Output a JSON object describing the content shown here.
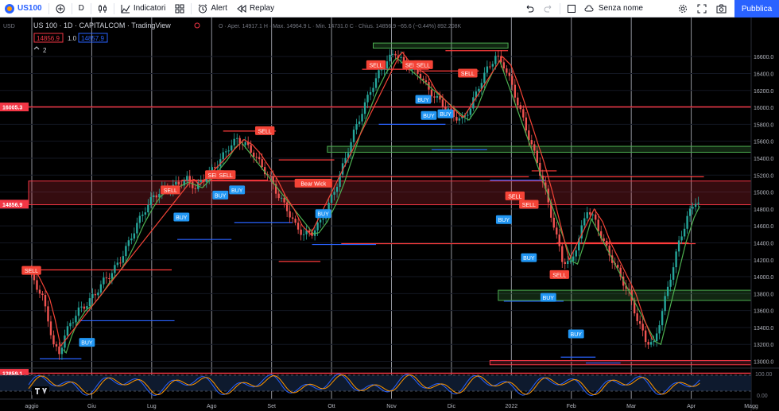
{
  "toolbar": {
    "symbol": "US100",
    "interval": "D",
    "indicators_label": "Indicatori",
    "alert_label": "Alert",
    "replay_label": "Replay",
    "layout_name": "Senza nome",
    "publish_label": "Pubblica"
  },
  "legend": {
    "title": "US 100 · 1D · CAPITALCOM · TradingView",
    "ohlc": "O · Aper. 14917.1  H · Max. 14964.9  L · Min. 14731.0  C · Chius. 14856.9  −65.6 (−0.44%)  892.208K",
    "bid": "14856.9",
    "spread": "1.0",
    "ask": "14857.9",
    "collapse": "2"
  },
  "price_axis": {
    "currency": "USD",
    "tags": [
      {
        "label": "16005.3",
        "value": 16005.3,
        "color": "#f23645"
      },
      {
        "label": "14856.9",
        "value": 14856.9,
        "color": "#f23645"
      },
      {
        "label": "12859.1",
        "value": 12859.1,
        "color": "#f23645"
      }
    ]
  },
  "oscillator": {
    "levels": [
      "100.00",
      "0.00"
    ]
  },
  "colors": {
    "up": "#26a69a",
    "down": "#ef5350",
    "signal_sell": "#f44336",
    "signal_buy": "#2196f3",
    "support": "#2962ff",
    "resistance": "#ff3b3b",
    "zone_green": "#4caf50",
    "zone_red": "#f23645"
  },
  "chart_data": {
    "type": "line",
    "instrument": "US 100",
    "timeframe": "1D",
    "yticks": [
      13000,
      13200,
      13400,
      13600,
      13800,
      14000,
      14200,
      14400,
      14600,
      14800,
      15000,
      15200,
      15400,
      15600,
      15800,
      16000,
      16200,
      16400,
      16600
    ],
    "ylim": [
      12930,
      16780
    ],
    "xticks": [
      "aggio",
      "Giu",
      "Lug",
      "Ago",
      "Set",
      "Ott",
      "Nov",
      "Dic",
      "2022",
      "Feb",
      "Mar",
      "Apr",
      "Magg"
    ],
    "series": [
      {
        "color": "#26a69a",
        "points": [
          [
            0.0,
            14080
          ],
          [
            0.4,
            13950
          ],
          [
            1.0,
            13750
          ],
          [
            1.4,
            13500
          ],
          [
            1.8,
            13180
          ],
          [
            2.2,
            13100
          ],
          [
            2.6,
            13300
          ],
          [
            3.0,
            13450
          ],
          [
            3.6,
            13600
          ],
          [
            4.2,
            13680
          ],
          [
            4.8,
            13800
          ],
          [
            5.4,
            13950
          ],
          [
            6.0,
            14050
          ],
          [
            6.6,
            14200
          ],
          [
            7.2,
            14400
          ],
          [
            7.8,
            14620
          ],
          [
            8.4,
            14800
          ],
          [
            9.0,
            14950
          ],
          [
            9.6,
            15020
          ],
          [
            10.2,
            15050
          ],
          [
            10.8,
            15100
          ],
          [
            11.4,
            15150
          ],
          [
            12.0,
            15050
          ],
          [
            12.6,
            15150
          ],
          [
            13.2,
            15260
          ],
          [
            13.8,
            15380
          ],
          [
            14.4,
            15530
          ],
          [
            15.0,
            15620
          ],
          [
            15.6,
            15560
          ],
          [
            16.2,
            15450
          ],
          [
            16.8,
            15300
          ],
          [
            17.4,
            15150
          ],
          [
            18.0,
            14950
          ],
          [
            18.6,
            14800
          ],
          [
            19.2,
            14600
          ],
          [
            19.8,
            14500
          ],
          [
            20.4,
            14520
          ],
          [
            21.0,
            14650
          ],
          [
            21.6,
            14850
          ],
          [
            22.2,
            15100
          ],
          [
            22.8,
            15400
          ],
          [
            23.4,
            15700
          ],
          [
            24.0,
            15950
          ],
          [
            24.6,
            16200
          ],
          [
            25.2,
            16400
          ],
          [
            25.8,
            16550
          ],
          [
            26.4,
            16650
          ],
          [
            27.0,
            16520
          ],
          [
            27.6,
            16450
          ],
          [
            28.2,
            16380
          ],
          [
            28.8,
            16200
          ],
          [
            29.4,
            16100
          ],
          [
            30.0,
            16000
          ],
          [
            30.6,
            15900
          ],
          [
            31.2,
            15850
          ],
          [
            31.8,
            16000
          ],
          [
            32.4,
            16250
          ],
          [
            33.0,
            16450
          ],
          [
            33.6,
            16600
          ],
          [
            34.2,
            16500
          ],
          [
            34.8,
            16250
          ],
          [
            35.4,
            15950
          ],
          [
            36.0,
            15650
          ],
          [
            36.6,
            15350
          ],
          [
            37.2,
            15000
          ],
          [
            37.8,
            14600
          ],
          [
            38.4,
            14200
          ],
          [
            39.0,
            14150
          ],
          [
            39.6,
            14450
          ],
          [
            40.2,
            14800
          ],
          [
            40.8,
            14650
          ],
          [
            41.4,
            14400
          ],
          [
            42.0,
            14200
          ],
          [
            42.6,
            14000
          ],
          [
            43.2,
            13800
          ],
          [
            43.8,
            13500
          ],
          [
            44.4,
            13250
          ],
          [
            45.0,
            13200
          ],
          [
            45.6,
            13600
          ],
          [
            46.2,
            14000
          ],
          [
            46.8,
            14400
          ],
          [
            47.4,
            14700
          ],
          [
            48.0,
            14900
          ],
          [
            48.4,
            14850
          ]
        ]
      }
    ],
    "xlim": [
      0,
      52
    ],
    "sell_labels": [
      {
        "x": 0.2,
        "y": 14070,
        "text": "SELL"
      },
      {
        "x": 10.2,
        "y": 15020,
        "text": "SELL"
      },
      {
        "x": 13.4,
        "y": 15200,
        "text": "SELL"
      },
      {
        "x": 14.2,
        "y": 15200,
        "text": "SELL"
      },
      {
        "x": 17.0,
        "y": 15720,
        "text": "SELL"
      },
      {
        "x": 20.5,
        "y": 15100,
        "text": "Bear Wick"
      },
      {
        "x": 25.0,
        "y": 16500,
        "text": "SELL"
      },
      {
        "x": 27.6,
        "y": 16500,
        "text": "SELL"
      },
      {
        "x": 28.4,
        "y": 16500,
        "text": "SELL"
      },
      {
        "x": 31.6,
        "y": 16400,
        "text": "SELL"
      },
      {
        "x": 35.0,
        "y": 14950,
        "text": "SELL"
      },
      {
        "x": 36.0,
        "y": 14850,
        "text": "SELL"
      },
      {
        "x": 38.2,
        "y": 14020,
        "text": "SELL"
      }
    ],
    "buy_labels": [
      {
        "x": 4.2,
        "y": 13220,
        "text": "BUY"
      },
      {
        "x": 11.0,
        "y": 14700,
        "text": "BUY"
      },
      {
        "x": 13.8,
        "y": 14960,
        "text": "BUY"
      },
      {
        "x": 15.0,
        "y": 15020,
        "text": "BUY"
      },
      {
        "x": 21.2,
        "y": 14740,
        "text": "BUY"
      },
      {
        "x": 28.4,
        "y": 16090,
        "text": "BUY"
      },
      {
        "x": 28.8,
        "y": 15900,
        "text": "BUY"
      },
      {
        "x": 30.0,
        "y": 15920,
        "text": "BUY"
      },
      {
        "x": 34.2,
        "y": 14670,
        "text": "BUY"
      },
      {
        "x": 36.0,
        "y": 14220,
        "text": "BUY"
      },
      {
        "x": 37.4,
        "y": 13750,
        "text": "BUY"
      },
      {
        "x": 39.4,
        "y": 13320,
        "text": "BUY"
      }
    ]
  }
}
